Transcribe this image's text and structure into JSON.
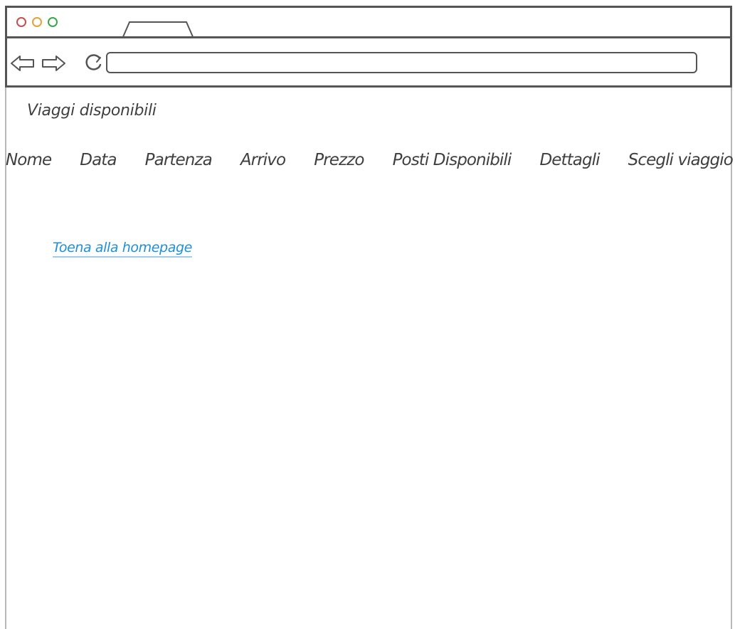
{
  "window": {
    "controls": [
      {
        "name": "close",
        "color": "#c94d4d"
      },
      {
        "name": "minimize",
        "color": "#e3a23c"
      },
      {
        "name": "maximize",
        "color": "#3aa64a"
      }
    ]
  },
  "toolbar": {
    "back_icon": "arrow-left-icon",
    "forward_icon": "arrow-right-icon",
    "reload_icon": "reload-icon",
    "url_value": ""
  },
  "page": {
    "title": "Viaggi disponibili",
    "table": {
      "columns": [
        "Nome",
        "Data",
        "Partenza",
        "Arrivo",
        "Prezzo",
        "Posti Disponibili",
        "Dettagli",
        "Scegli viaggio"
      ],
      "rows": []
    },
    "home_link": "Toena alla homepage"
  },
  "colors": {
    "frame": "#555555",
    "link": "#1e8fd8",
    "text": "#3f3f3f"
  }
}
